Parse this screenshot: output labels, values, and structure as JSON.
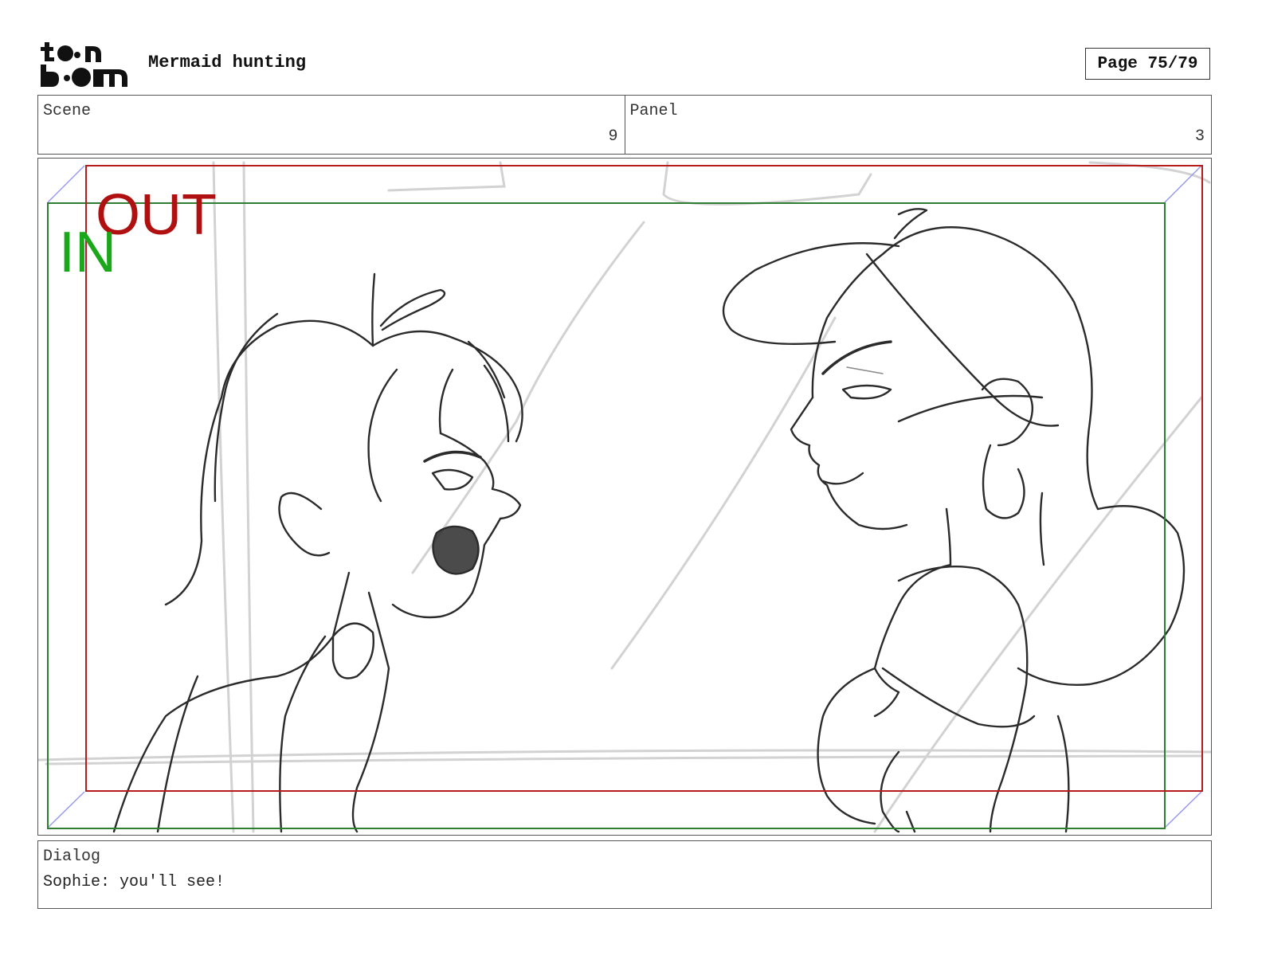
{
  "header": {
    "logo_text": "toon boom",
    "project_title": "Mermaid hunting",
    "page_label": "Page 75/79"
  },
  "info": {
    "scene_label": "Scene",
    "scene_value": "9",
    "panel_label": "Panel",
    "panel_value": "3"
  },
  "panel": {
    "in_label": "IN",
    "out_label": "OUT",
    "in_color": "#1aa81a",
    "out_color": "#b01010",
    "in_frame_color": "#2e7d32",
    "out_frame_color": "#b71c1c",
    "sketch_color": "#2b2b2b",
    "guide_color": "#cfcfcf"
  },
  "dialog": {
    "label": "Dialog",
    "text": "Sophie: you'll see!"
  }
}
